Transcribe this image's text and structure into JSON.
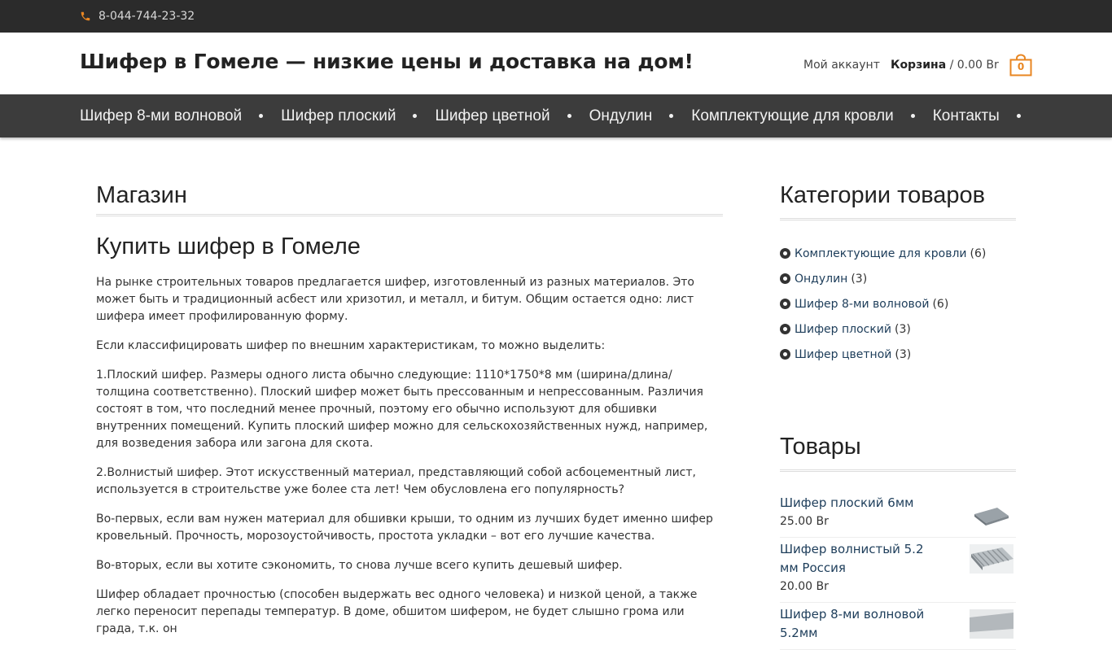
{
  "topbar": {
    "phone": "8-044-744-23-32"
  },
  "header": {
    "site_title": "Шифер в Гомеле — низкие цены и доставка на дом!",
    "account_label": "Мой аккаунт",
    "cart_label": "Корзина",
    "cart_total": "/ 0.00 Br",
    "cart_count": "0"
  },
  "nav": {
    "items": [
      {
        "label": "Шифер 8-ми волновой"
      },
      {
        "label": "Шифер плоский"
      },
      {
        "label": "Шифер цветной"
      },
      {
        "label": "Ондулин"
      },
      {
        "label": "Комплектующие для кровли"
      },
      {
        "label": "Контакты"
      }
    ]
  },
  "main": {
    "page_title": "Магазин",
    "article_title": "Купить шифер в Гомеле",
    "paragraphs": [
      "На рынке строительных товаров предлагается шифер, изготовленный из разных материалов. Это может быть и традиционный асбест или хризотил, и металл, и битум. Общим остается одно: лист шифера имеет профилированную форму.",
      "Если классифицировать шифер по внешним характеристикам, то можно выделить:",
      "1.Плоский шифер. Размеры одного листа обычно следующие: 1110*1750*8 мм (ширина/длина/толщина соответственно). Плоский шифер может быть прессованным и непрессованным. Различия состоят в том, что последний менее прочный, поэтому его обычно используют для обшивки внутренних помещений. Купить плоский шифер можно для сельскохозяйственных нужд, например, для возведения забора или загона для скота.",
      "2.Волнистый шифер. Этот искусственный материал, представляющий собой асбоцементный лист, используется в строительстве уже более ста лет! Чем обусловлена его популярность?",
      "Во-первых, если вам нужен материал для обшивки крыши, то одним из лучших будет именно шифер кровельный. Прочность, морозоустойчивость, простота укладки – вот его лучшие качества.",
      "Во-вторых, если вы хотите сэкономить, то снова лучше всего купить дешевый шифер.",
      "Шифер обладает прочностью (способен выдержать вес одного человека) и низкой ценой, а также легко переносит перепады температур. В доме, обшитом шифером, не будет слышно грома или града, т.к. он"
    ]
  },
  "sidebar": {
    "categories_title": "Категории товаров",
    "categories": [
      {
        "name": "Комплектующие для кровли",
        "count": "(6)"
      },
      {
        "name": "Ондулин",
        "count": "(3)"
      },
      {
        "name": "Шифер 8-ми волновой",
        "count": "(6)"
      },
      {
        "name": "Шифер плоский",
        "count": "(3)"
      },
      {
        "name": "Шифер цветной",
        "count": "(3)"
      }
    ],
    "products_title": "Товары",
    "products": [
      {
        "name": "Шифер плоский 6мм",
        "price": "25.00 Br"
      },
      {
        "name": "Шифер волнистый 5.2 мм Россия",
        "price": "20.00 Br"
      },
      {
        "name": "Шифер 8-ми волновой 5.2мм",
        "price": ""
      }
    ]
  },
  "colors": {
    "accent": "#e88622",
    "topbar": "#2b2b2b",
    "nav": "#3c3c3c",
    "link": "#1d3d5a"
  }
}
